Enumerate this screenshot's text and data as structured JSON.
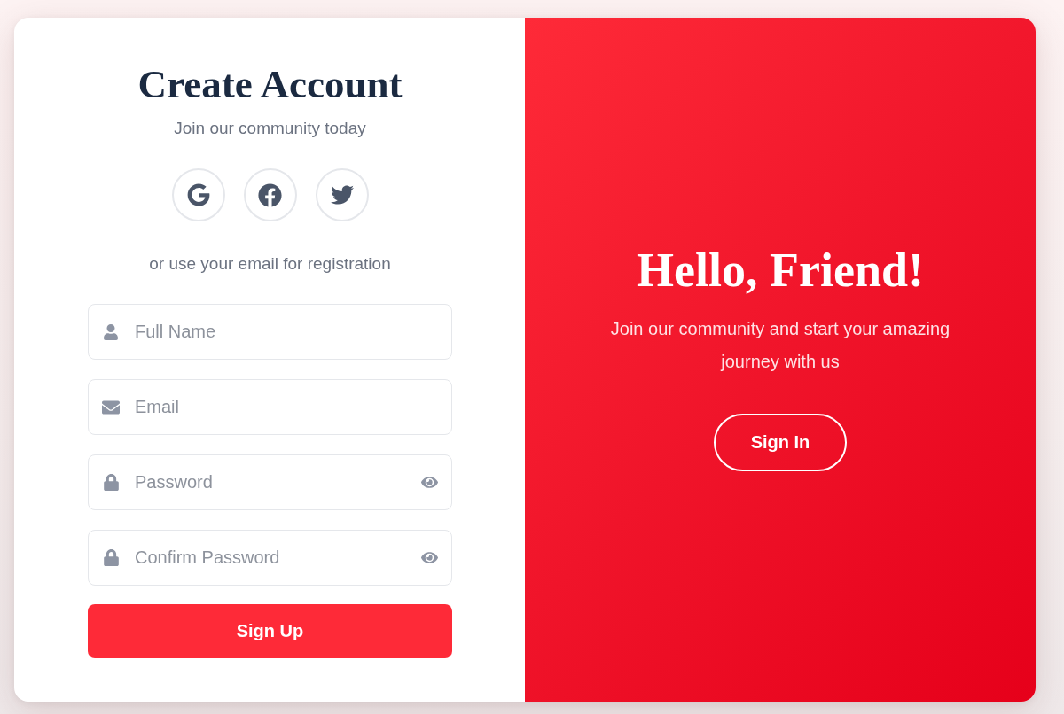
{
  "signup": {
    "title": "Create Account",
    "subtitle": "Join our community today",
    "social_buttons": [
      {
        "kind": "google"
      },
      {
        "kind": "facebook"
      },
      {
        "kind": "twitter"
      }
    ],
    "divider_text": "or use your email for registration",
    "fields": [
      {
        "kind": "name",
        "placeholder": "Full Name"
      },
      {
        "kind": "email",
        "placeholder": "Email"
      },
      {
        "kind": "password",
        "placeholder": "Password"
      },
      {
        "kind": "password",
        "placeholder": "Confirm Password"
      }
    ],
    "submit_button": "Sign Up"
  },
  "welcome": {
    "title": "Hello, Friend!",
    "message": "Join our community and start your amazing journey with us",
    "button": "Sign In"
  }
}
